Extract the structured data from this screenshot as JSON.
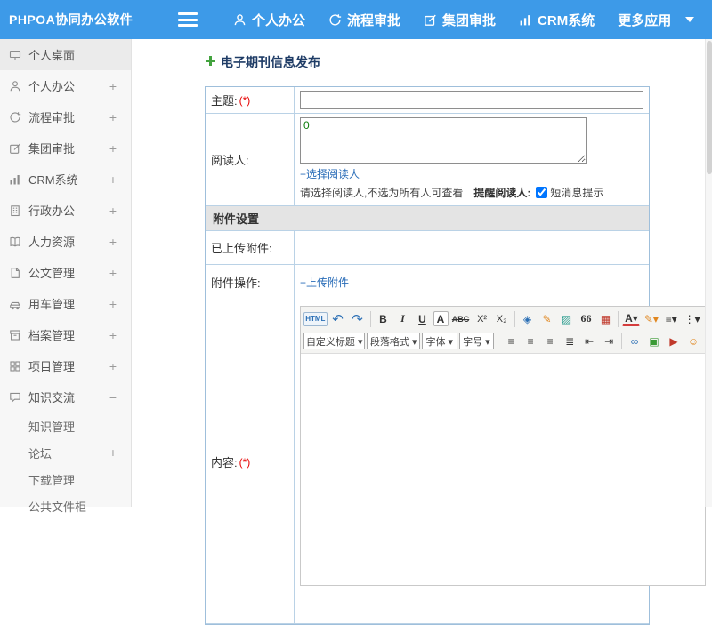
{
  "colors": {
    "header_blue": "#3d9ae8",
    "link_blue": "#2a6db8",
    "required_red": "#e60000",
    "title_navy": "#1f3c66",
    "plus_green": "#43a33e"
  },
  "header": {
    "logo": "PHPOA协同办公软件",
    "nav": [
      {
        "label": "个人办公",
        "icon": "person-icon"
      },
      {
        "label": "流程审批",
        "icon": "process-icon"
      },
      {
        "label": "集团审批",
        "icon": "approval-icon"
      },
      {
        "label": "CRM系统",
        "icon": "chart-icon"
      },
      {
        "label": "更多应用",
        "icon": "caret-down-icon"
      }
    ]
  },
  "sidebar": {
    "items": [
      {
        "label": "个人桌面",
        "expand": ""
      },
      {
        "label": "个人办公",
        "expand": "+"
      },
      {
        "label": "流程审批",
        "expand": "+"
      },
      {
        "label": "集团审批",
        "expand": "+"
      },
      {
        "label": "CRM系统",
        "expand": "+"
      },
      {
        "label": "行政办公",
        "expand": "+"
      },
      {
        "label": "人力资源",
        "expand": "+"
      },
      {
        "label": "公文管理",
        "expand": "+"
      },
      {
        "label": "用车管理",
        "expand": "+"
      },
      {
        "label": "档案管理",
        "expand": "+"
      },
      {
        "label": "项目管理",
        "expand": "+"
      },
      {
        "label": "知识交流",
        "expand": "−"
      }
    ],
    "subitems": [
      {
        "label": "知识管理",
        "expand": ""
      },
      {
        "label": "论坛",
        "expand": "+"
      },
      {
        "label": "下载管理",
        "expand": ""
      },
      {
        "label": "公共文件柜",
        "expand": ""
      }
    ]
  },
  "main": {
    "page_title": "电子期刊信息发布",
    "form": {
      "subject_label": "主题:",
      "required_mark": "(*)",
      "readers_label": "阅读人:",
      "readers_count": "0",
      "select_readers_link": "+选择阅读人",
      "readers_hint": "请选择阅读人,不选为所有人可查看",
      "remind_readers_label": "提醒阅读人:",
      "sms_notice_label": "短消息提示",
      "attachment_section_title": "附件设置",
      "uploaded_attachments_label": "已上传附件:",
      "attachment_actions_label": "附件操作:",
      "upload_attachment_link": "+上传附件",
      "content_label": "内容:",
      "editor": {
        "toolbar_row1": [
          {
            "name": "html-source-button",
            "glyph": "HTML",
            "cls": "html"
          },
          {
            "name": "undo-button",
            "glyph": "↶",
            "cls": "blue bigger"
          },
          {
            "name": "redo-button",
            "glyph": "↷",
            "cls": "blue bigger"
          },
          {
            "sep": true
          },
          {
            "name": "bold-button",
            "glyph": "B",
            "cls": "b"
          },
          {
            "name": "italic-button",
            "glyph": "I",
            "cls": "i"
          },
          {
            "name": "underline-button",
            "glyph": "U",
            "cls": "u"
          },
          {
            "name": "font-style-button",
            "glyph": "A",
            "cls": "b boxed"
          },
          {
            "name": "strikethrough-button",
            "glyph": "ABC",
            "cls": "strike"
          },
          {
            "name": "superscript-button",
            "glyph": "X²",
            "cls": "small"
          },
          {
            "name": "subscript-button",
            "glyph": "X₂",
            "cls": "small"
          },
          {
            "sep": true
          },
          {
            "name": "eraser-button",
            "glyph": "◈",
            "cls": "blue"
          },
          {
            "name": "format-painter-button",
            "glyph": "✎",
            "cls": "orange"
          },
          {
            "name": "fill-color-button",
            "glyph": "▨",
            "cls": "teal"
          },
          {
            "name": "blockquote-button",
            "glyph": "66",
            "cls": "quote"
          },
          {
            "name": "table-button",
            "glyph": "▦",
            "cls": "red"
          },
          {
            "sep": true
          },
          {
            "name": "font-color-button",
            "glyph": "A▾",
            "cls": "fontcolor"
          },
          {
            "name": "highlight-color-button",
            "glyph": "✎▾",
            "cls": "orange"
          },
          {
            "name": "list-button",
            "glyph": "≡▾",
            "cls": ""
          },
          {
            "name": "more-button",
            "glyph": "⋮▾",
            "cls": ""
          }
        ],
        "toolbar_row2": [
          {
            "name": "heading-select",
            "glyph": "自定义标题 ▾",
            "cls": "select"
          },
          {
            "name": "paragraph-format-select",
            "glyph": "段落格式 ▾",
            "cls": "select"
          },
          {
            "name": "font-family-select",
            "glyph": "字体 ▾",
            "cls": "select"
          },
          {
            "name": "font-size-select",
            "glyph": "字号 ▾",
            "cls": "select"
          },
          {
            "sep": true
          },
          {
            "name": "align-left-button",
            "glyph": "≡"
          },
          {
            "name": "align-center-button",
            "glyph": "≡"
          },
          {
            "name": "align-right-button",
            "glyph": "≡"
          },
          {
            "name": "justify-button",
            "glyph": "≣"
          },
          {
            "name": "outdent-button",
            "glyph": "⇤"
          },
          {
            "name": "indent-button",
            "glyph": "⇥"
          },
          {
            "sep": true
          },
          {
            "name": "link-button",
            "glyph": "∞",
            "cls": "blue"
          },
          {
            "name": "image-button",
            "glyph": "▣",
            "cls": "green"
          },
          {
            "name": "media-button",
            "glyph": "▶",
            "cls": "red"
          },
          {
            "name": "emoticon-button",
            "glyph": "☺",
            "cls": "orange"
          }
        ]
      }
    }
  }
}
